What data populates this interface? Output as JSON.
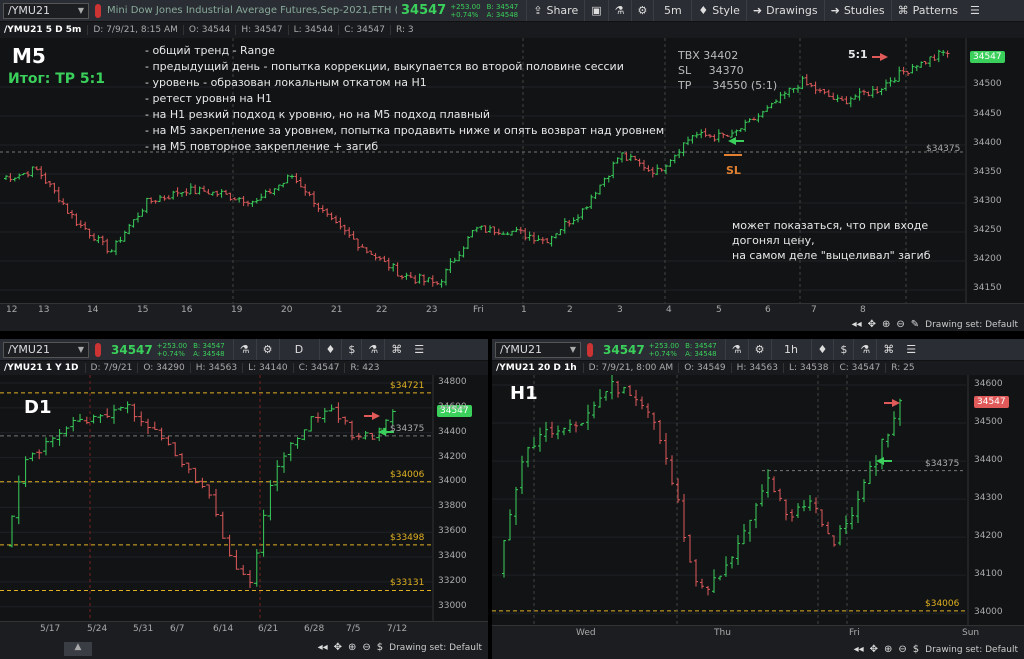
{
  "top": {
    "symbol": "/YMU21",
    "description": "Mini Dow Jones Industrial Average Futures,Sep-2021,ETH (pre...",
    "price": "34547",
    "change": "+253.00",
    "change_pct": "+0.74%",
    "bid": "B: 34547",
    "ask": "A: 34548",
    "share": "Share",
    "interval": "5m",
    "style": "Style",
    "drawings": "Drawings",
    "studies": "Studies",
    "patterns": "Patterns"
  },
  "m5": {
    "info": [
      "/YMU21 5 D 5m",
      "D: 7/9/21, 8:15 AM",
      "O: 34544",
      "H: 34547",
      "L: 34544",
      "C: 34547",
      "R: 3"
    ],
    "title": "M5",
    "result": "Итог: ТР  5:1",
    "notes": [
      "- общий тренд - Range",
      "- предыдущий день - попытка коррекции, выкупается во второй половине сессии",
      "- уровень - образован локальным откатом на Н1",
      "- ретест уровня на Н1",
      "- на Н1 резкий подход к уровню, но на М5 подход плавный",
      "- на М5 закрепление за уровнем, попытка продавить ниже и опять возврат над уровнем",
      "- на М5 повторное закрепление + загиб"
    ],
    "trade": [
      "ТВХ  34402",
      "SL     34370",
      "TP      34550 (5:1)"
    ],
    "ratio": "5:1",
    "sl": "SL",
    "side_note": [
      "может показаться, что при входе",
      "догонял цену,",
      "на самом деле \"выцеливал\" загиб"
    ],
    "level": "$34375",
    "price_tag": "34547",
    "y_ticks": [
      "34500",
      "34450",
      "34400",
      "34350",
      "34300",
      "34250",
      "34200",
      "34150"
    ],
    "x_ticks": [
      "12",
      "13",
      "14",
      "15",
      "16",
      "19",
      "20",
      "21",
      "22",
      "23",
      "Fri",
      "1",
      "2",
      "3",
      "4",
      "5",
      "6",
      "7",
      "8"
    ],
    "drawing_set": "Drawing set: Default"
  },
  "d1": {
    "symbol": "/YMU21",
    "price": "34547",
    "change": "+253.00",
    "change_pct": "+0.74%",
    "bid": "B: 34547",
    "ask": "A: 34548",
    "interval": "D",
    "info": [
      "/YMU21 1 Y 1D",
      "D: 7/9/21",
      "O: 34290",
      "H: 34563",
      "L: 34140",
      "C: 34547",
      "R: 423"
    ],
    "title": "D1",
    "levels": [
      "$34721",
      "$34375",
      "$34006",
      "$33498",
      "$33131"
    ],
    "price_tag": "34547",
    "y_ticks": [
      "34800",
      "34600",
      "34400",
      "34200",
      "34000",
      "33800",
      "33600",
      "33400",
      "33200",
      "33000"
    ],
    "x_ticks": [
      "5/17",
      "5/24",
      "5/31",
      "6/7",
      "6/14",
      "6/21",
      "6/28",
      "7/5",
      "7/12"
    ],
    "drawing_set": "Drawing set: Default"
  },
  "h1": {
    "symbol": "/YMU21",
    "price": "34547",
    "change": "+253.00",
    "change_pct": "+0.74%",
    "bid": "B: 34547",
    "ask": "A: 34548",
    "interval": "1h",
    "info": [
      "/YMU21 20 D 1h",
      "D: 7/9/21, 8:00 AM",
      "O: 34549",
      "H: 34563",
      "L: 34538",
      "C: 34547",
      "R: 25"
    ],
    "title": "H1",
    "levels": [
      "$34375",
      "$34006"
    ],
    "price_tag": "34547",
    "y_ticks": [
      "34600",
      "34500",
      "34400",
      "34300",
      "34200",
      "34100",
      "34000"
    ],
    "x_ticks": [
      "Wed",
      "Thu",
      "Fri",
      "Sun"
    ],
    "drawing_set": "Drawing set: Default"
  },
  "colors": {
    "up": "#3ad05b",
    "down": "#e05a5a",
    "level": "#e0b020",
    "bg": "#111315"
  }
}
